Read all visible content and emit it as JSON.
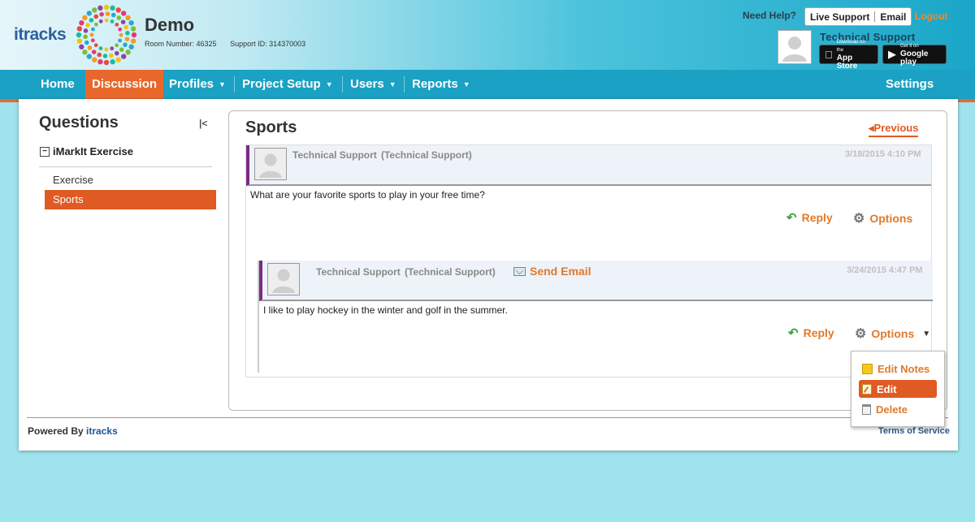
{
  "header": {
    "logo_text": "itracks",
    "title": "Demo",
    "room_number": "Room Number: 46325",
    "support_id": "Support ID: 314370003",
    "need_help": "Need Help?",
    "live_support": "Live Support",
    "email": "Email",
    "logout": "Logout",
    "user_name": "Technical Support",
    "app_store_small": "Download on the",
    "app_store": "App Store",
    "google_play_small": "Get it on",
    "google_play": "Google play"
  },
  "nav": {
    "home": "Home",
    "discussion": "Discussion",
    "profiles": "Profiles",
    "project_setup": "Project Setup",
    "users": "Users",
    "reports": "Reports",
    "settings": "Settings"
  },
  "questions": {
    "title": "Questions",
    "group": "iMarkIt Exercise",
    "items": [
      {
        "label": "Exercise"
      },
      {
        "label": "Sports"
      }
    ]
  },
  "content": {
    "title": "Sports",
    "previous": "Previous",
    "post": {
      "author": "Technical Support",
      "role": "(Technical Support)",
      "date": "3/18/2015 4:10 PM",
      "text": "What are your favorite sports to play in your free time?",
      "reply": "Reply",
      "options": "Options"
    },
    "reply_post": {
      "author": "Technical Support",
      "role": "(Technical Support)",
      "send_email": "Send Email",
      "date": "3/24/2015 4:47 PM",
      "text": "I like to play hockey in the winter and golf in the summer.",
      "reply": "Reply",
      "options": "Options"
    }
  },
  "options_menu": {
    "edit_notes": "Edit Notes",
    "edit": "Edit",
    "delete": "Delete"
  },
  "footer": {
    "powered_by": "Powered By",
    "brand": "itracks",
    "terms": "Terms of Service"
  },
  "colors": {
    "accent": "#e8682c",
    "nav": "#1aa1c3",
    "page_bg": "#9ee3ee",
    "post_marker": "#7b2a85"
  }
}
